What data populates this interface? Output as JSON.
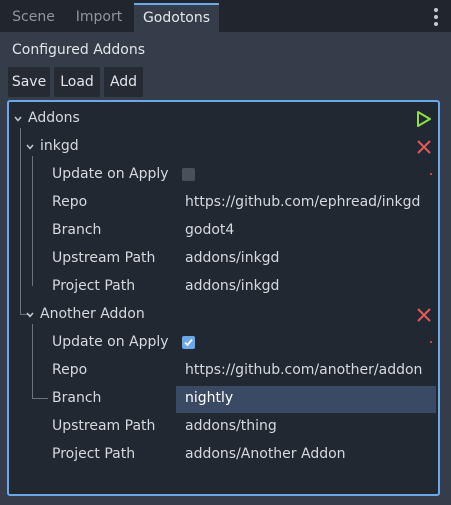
{
  "tabs": [
    {
      "label": "Scene",
      "active": false
    },
    {
      "label": "Import",
      "active": false
    },
    {
      "label": "Godotons",
      "active": true
    }
  ],
  "panel": {
    "title": "Configured Addons",
    "buttons": {
      "save": "Save",
      "load": "Load",
      "add": "Add"
    }
  },
  "tree": {
    "root_label": "Addons",
    "addons": [
      {
        "name": "inkgd",
        "update_on_apply": false,
        "fields": {
          "update_label": "Update on Apply",
          "repo_label": "Repo",
          "repo_value": "https://github.com/ephread/inkgd",
          "branch_label": "Branch",
          "branch_value": "godot4",
          "upstream_label": "Upstream Path",
          "upstream_value": "addons/inkgd",
          "project_label": "Project Path",
          "project_value": "addons/inkgd"
        }
      },
      {
        "name": "Another Addon",
        "update_on_apply": true,
        "fields": {
          "update_label": "Update on Apply",
          "repo_label": "Repo",
          "repo_value": "https://github.com/another/addon",
          "branch_label": "Branch",
          "branch_value": "nightly",
          "upstream_label": "Upstream Path",
          "upstream_value": "addons/thing",
          "project_label": "Project Path",
          "project_value": "addons/Another Addon"
        }
      }
    ]
  },
  "icons": {
    "run": "play-icon",
    "remove": "close-icon",
    "menu": "kebab-menu-icon",
    "expand": "chevron-down-icon",
    "checked": "checkmark-icon"
  },
  "colors": {
    "accent": "#6aa8ea",
    "play": "#8ee04a",
    "remove": "#e25a5a",
    "selection": "#3a4a64"
  }
}
